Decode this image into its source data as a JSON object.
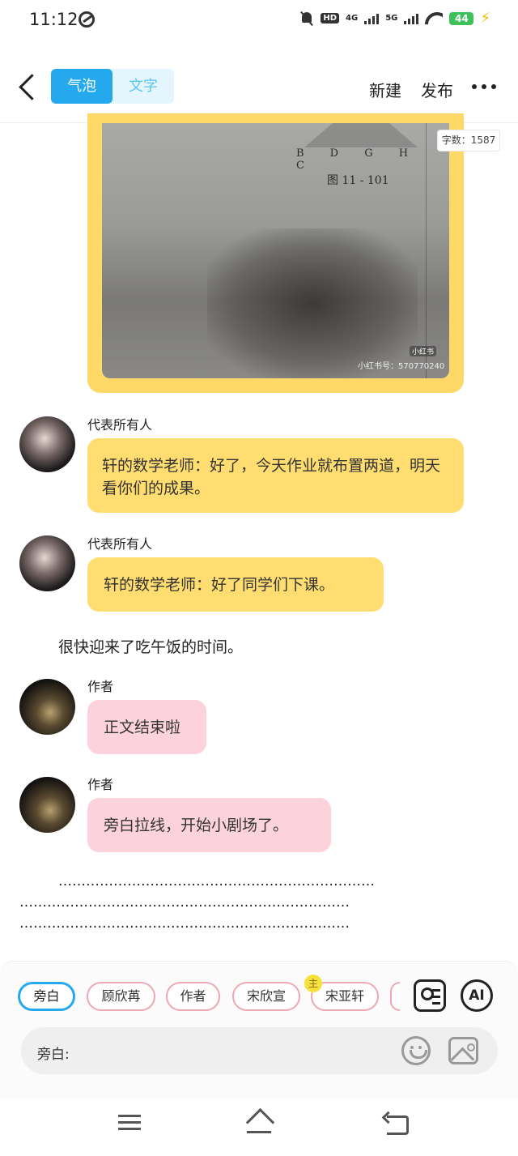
{
  "status_bar": {
    "time": "11:12",
    "hd_label": "HD",
    "net1": "4G",
    "net2": "5G",
    "battery": "44"
  },
  "header": {
    "tabs": [
      {
        "label": "气泡",
        "active": true
      },
      {
        "label": "文字",
        "active": false
      }
    ],
    "new_label": "新建",
    "publish_label": "发布"
  },
  "word_count": "字数：1587",
  "photo": {
    "figure_letters": "B D G H C",
    "figure_caption": "图 11 - 101",
    "watermark_logo": "小红书",
    "watermark_id": "小红书号：570770240"
  },
  "messages": [
    {
      "sender": "代表所有人",
      "text": "轩的数学老师：好了，今天作业就布置两道，明天看你们的成果。",
      "style": "yellow"
    },
    {
      "sender": "代表所有人",
      "text": "轩的数学老师：好了同学们下课。",
      "style": "yellow"
    },
    {
      "sender": "作者",
      "text": "正文结束啦",
      "style": "pink"
    },
    {
      "sender": "作者",
      "text": "旁白拉线，开始小剧场了。",
      "style": "pink"
    }
  ],
  "narration": "很快迎来了吃午饭的时间。",
  "dot_lines": [
    "……………………………………………………………",
    "………………………………………………………………",
    "………………………………………………………………"
  ],
  "role_chips": [
    {
      "label": "旁白",
      "active": true
    },
    {
      "label": "顾欣苒",
      "active": false
    },
    {
      "label": "作者",
      "active": false
    },
    {
      "label": "宋欣宣",
      "active": false
    },
    {
      "label": "宋亚轩",
      "active": false,
      "badge": "主"
    }
  ],
  "ai_label": "AI",
  "input": {
    "label": "旁白:",
    "value": "",
    "placeholder": ""
  },
  "colors": {
    "accent": "#24a9ef",
    "yellow_bubble": "#ffdd70",
    "pink_bubble": "#fcd3dc",
    "chip_border": "#f0a7b4"
  }
}
